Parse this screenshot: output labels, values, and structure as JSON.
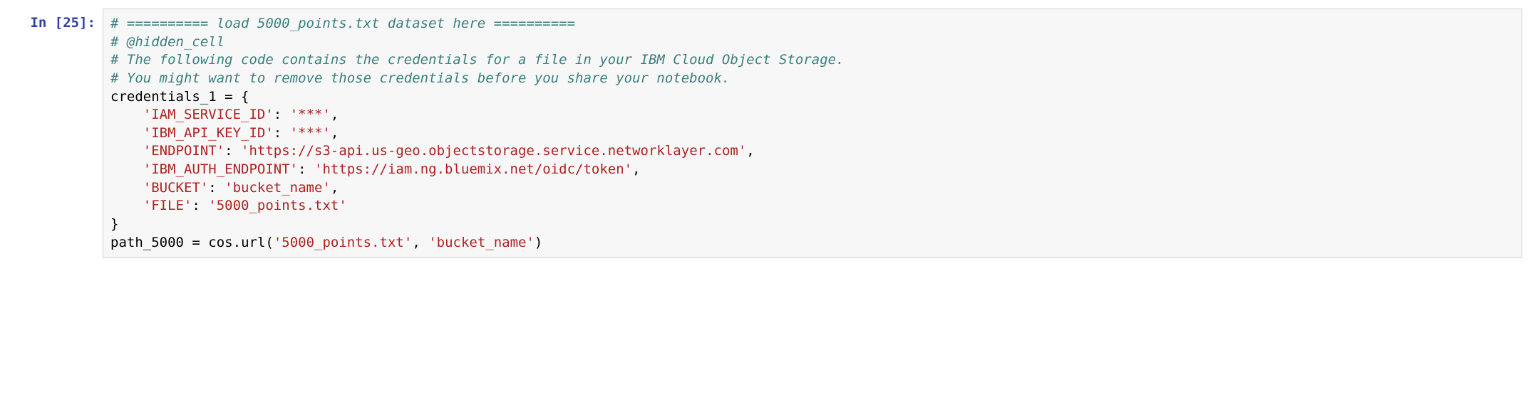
{
  "cell": {
    "prompt_label": "In [25]:",
    "code": {
      "line1_comment": "# ========== load 5000_points.txt dataset here ==========",
      "line2_comment": "# @hidden_cell",
      "line3_comment": "# The following code contains the credentials for a file in your IBM Cloud Object Storage.",
      "line4_comment": "# You might want to remove those credentials before you share your notebook.",
      "var_credentials": "credentials_1",
      "eq": " = ",
      "brace_open": "{",
      "indent": "    ",
      "k1": "'IAM_SERVICE_ID'",
      "v1": "'***'",
      "k2": "'IBM_API_KEY_ID'",
      "v2": "'***'",
      "k3": "'ENDPOINT'",
      "v3": "'https://s3-api.us-geo.objectstorage.service.networklayer.com'",
      "k4": "'IBM_AUTH_ENDPOINT'",
      "v4": "'https://iam.ng.bluemix.net/oidc/token'",
      "k5": "'BUCKET'",
      "v5": "'bucket_name'",
      "k6": "'FILE'",
      "v6": "'5000_points.txt'",
      "brace_close": "}",
      "colon": ": ",
      "comma": ",",
      "var_path": "path_5000",
      "call_obj": "cos",
      "dot": ".",
      "call_fn": "url",
      "paren_open": "(",
      "arg1": "'5000_points.txt'",
      "argsep": ", ",
      "arg2": "'bucket_name'",
      "paren_close": ")"
    }
  }
}
